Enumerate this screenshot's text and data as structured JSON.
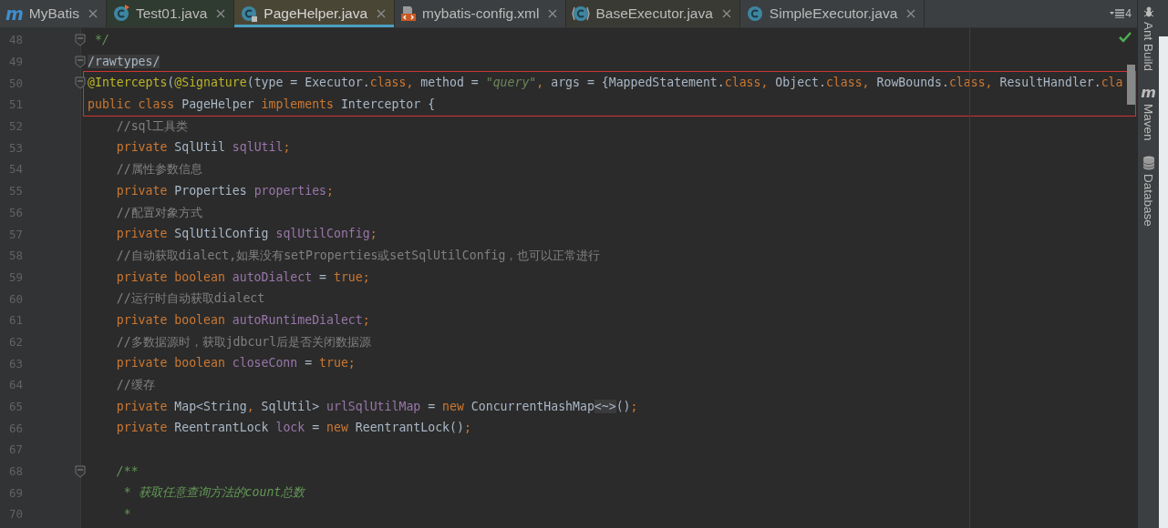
{
  "tabs": [
    {
      "label": "MyBatis",
      "kind": "module",
      "glyph": "m",
      "selected": false,
      "color": "#3c3f41"
    },
    {
      "label": "Test01.java",
      "kind": "class_run",
      "selected": false,
      "color": "#2f3a30"
    },
    {
      "label": "PageHelper.java",
      "kind": "class_locked",
      "selected": true,
      "color": "#4a4636"
    },
    {
      "label": "mybatis-config.xml",
      "kind": "xml",
      "selected": false,
      "color": "#3c3f41"
    },
    {
      "label": "BaseExecutor.java",
      "kind": "class_bracket",
      "selected": false,
      "color": "#3a3a35"
    },
    {
      "label": "SimpleExecutor.java",
      "kind": "class",
      "selected": false,
      "color": "#3c3f41"
    }
  ],
  "hidden_tabs_count": "4",
  "editor": {
    "lines": [
      {
        "number": "48",
        "fold": true,
        "boxed": false,
        "tokens": [
          {
            "kind": "doc",
            "text": " */"
          }
        ]
      },
      {
        "number": "49",
        "fold": true,
        "boxed": false,
        "tokens": [
          {
            "kind": "highlight",
            "text": "/rawtypes/"
          }
        ]
      },
      {
        "number": "50",
        "fold": true,
        "boxed": true,
        "tokens": [
          {
            "kind": "annotation",
            "text": "@Intercepts"
          },
          {
            "kind": "plain",
            "text": "("
          },
          {
            "kind": "annotation",
            "text": "@Signature"
          },
          {
            "kind": "plain",
            "text": "(type = Executor."
          },
          {
            "kind": "keyword",
            "text": "class, "
          },
          {
            "kind": "plain",
            "text": "method = "
          },
          {
            "kind": "string",
            "text": "\"query\""
          },
          {
            "kind": "keyword",
            "text": ", "
          },
          {
            "kind": "plain",
            "text": "args = {MappedStatement."
          },
          {
            "kind": "keyword",
            "text": "class, "
          },
          {
            "kind": "plain",
            "text": "Object."
          },
          {
            "kind": "keyword",
            "text": "class, "
          },
          {
            "kind": "plain",
            "text": "RowBounds."
          },
          {
            "kind": "keyword",
            "text": "class, "
          },
          {
            "kind": "plain",
            "text": "ResultHandler."
          },
          {
            "kind": "keyword",
            "text": "cla"
          }
        ]
      },
      {
        "number": "51",
        "fold": false,
        "boxed": true,
        "tokens": [
          {
            "kind": "keyword",
            "text": "public class "
          },
          {
            "kind": "plain",
            "text": "PageHelper "
          },
          {
            "kind": "keyword",
            "text": "implements "
          },
          {
            "kind": "plain",
            "text": "Interceptor {"
          }
        ]
      },
      {
        "number": "52",
        "fold": false,
        "boxed": false,
        "tokens": [
          {
            "kind": "comment",
            "text": "    //sql工具类"
          }
        ]
      },
      {
        "number": "53",
        "fold": false,
        "boxed": false,
        "tokens": [
          {
            "kind": "keyword",
            "text": "    private "
          },
          {
            "kind": "plain",
            "text": "SqlUtil "
          },
          {
            "kind": "field",
            "text": "sqlUtil"
          },
          {
            "kind": "keyword",
            "text": ";"
          }
        ]
      },
      {
        "number": "54",
        "fold": false,
        "boxed": false,
        "tokens": [
          {
            "kind": "comment",
            "text": "    //属性参数信息"
          }
        ]
      },
      {
        "number": "55",
        "fold": false,
        "boxed": false,
        "tokens": [
          {
            "kind": "keyword",
            "text": "    private "
          },
          {
            "kind": "plain",
            "text": "Properties "
          },
          {
            "kind": "field",
            "text": "properties"
          },
          {
            "kind": "keyword",
            "text": ";"
          }
        ]
      },
      {
        "number": "56",
        "fold": false,
        "boxed": false,
        "tokens": [
          {
            "kind": "comment",
            "text": "    //配置对象方式"
          }
        ]
      },
      {
        "number": "57",
        "fold": false,
        "boxed": false,
        "tokens": [
          {
            "kind": "keyword",
            "text": "    private "
          },
          {
            "kind": "plain",
            "text": "SqlUtilConfig "
          },
          {
            "kind": "field",
            "text": "sqlUtilConfig"
          },
          {
            "kind": "keyword",
            "text": ";"
          }
        ]
      },
      {
        "number": "58",
        "fold": false,
        "boxed": false,
        "tokens": [
          {
            "kind": "comment",
            "text": "    //自动获取dialect,如果没有setProperties或setSqlUtilConfig，也可以正常进行"
          }
        ]
      },
      {
        "number": "59",
        "fold": false,
        "boxed": false,
        "tokens": [
          {
            "kind": "keyword",
            "text": "    private boolean "
          },
          {
            "kind": "field",
            "text": "autoDialect"
          },
          {
            "kind": "plain",
            "text": " = "
          },
          {
            "kind": "keyword",
            "text": "true;"
          }
        ]
      },
      {
        "number": "60",
        "fold": false,
        "boxed": false,
        "tokens": [
          {
            "kind": "comment",
            "text": "    //运行时自动获取dialect"
          }
        ]
      },
      {
        "number": "61",
        "fold": false,
        "boxed": false,
        "tokens": [
          {
            "kind": "keyword",
            "text": "    private boolean "
          },
          {
            "kind": "field",
            "text": "autoRuntimeDialect"
          },
          {
            "kind": "keyword",
            "text": ";"
          }
        ]
      },
      {
        "number": "62",
        "fold": false,
        "boxed": false,
        "tokens": [
          {
            "kind": "comment",
            "text": "    //多数据源时，获取jdbcurl后是否关闭数据源"
          }
        ]
      },
      {
        "number": "63",
        "fold": false,
        "boxed": false,
        "tokens": [
          {
            "kind": "keyword",
            "text": "    private boolean "
          },
          {
            "kind": "field",
            "text": "closeConn"
          },
          {
            "kind": "plain",
            "text": " = "
          },
          {
            "kind": "keyword",
            "text": "true;"
          }
        ]
      },
      {
        "number": "64",
        "fold": false,
        "boxed": false,
        "tokens": [
          {
            "kind": "comment",
            "text": "    //缓存"
          }
        ]
      },
      {
        "number": "65",
        "fold": false,
        "boxed": false,
        "tokens": [
          {
            "kind": "keyword",
            "text": "    private "
          },
          {
            "kind": "plain",
            "text": "Map<String"
          },
          {
            "kind": "keyword",
            "text": ", "
          },
          {
            "kind": "plain",
            "text": "SqlUtil> "
          },
          {
            "kind": "field",
            "text": "urlSqlUtilMap"
          },
          {
            "kind": "plain",
            "text": " = "
          },
          {
            "kind": "keyword",
            "text": "new "
          },
          {
            "kind": "plain",
            "text": "ConcurrentHashMap"
          },
          {
            "kind": "highlight",
            "text": "<~>"
          },
          {
            "kind": "plain",
            "text": "()"
          },
          {
            "kind": "keyword",
            "text": ";"
          }
        ]
      },
      {
        "number": "66",
        "fold": false,
        "boxed": false,
        "tokens": [
          {
            "kind": "keyword",
            "text": "    private "
          },
          {
            "kind": "plain",
            "text": "ReentrantLock "
          },
          {
            "kind": "field",
            "text": "lock"
          },
          {
            "kind": "plain",
            "text": " = "
          },
          {
            "kind": "keyword",
            "text": "new "
          },
          {
            "kind": "plain",
            "text": "ReentrantLock()"
          },
          {
            "kind": "keyword",
            "text": ";"
          }
        ]
      },
      {
        "number": "67",
        "fold": false,
        "boxed": false
      },
      {
        "number": "68",
        "fold": true,
        "boxed": false,
        "tokens": [
          {
            "kind": "doc",
            "text": "    /**"
          }
        ]
      },
      {
        "number": "69",
        "fold": false,
        "boxed": false,
        "tokens": [
          {
            "kind": "doc",
            "text": "     * 获取任意查询方法的count总数"
          }
        ]
      },
      {
        "number": "70",
        "fold": false,
        "boxed": false,
        "tokens": [
          {
            "kind": "doc",
            "text": "     *"
          }
        ]
      }
    ]
  },
  "tool_windows": [
    {
      "label": "Ant Build",
      "kind": "ant"
    },
    {
      "label": "Maven",
      "kind": "maven",
      "glyph": "m"
    },
    {
      "label": "Database",
      "kind": "database"
    }
  ]
}
